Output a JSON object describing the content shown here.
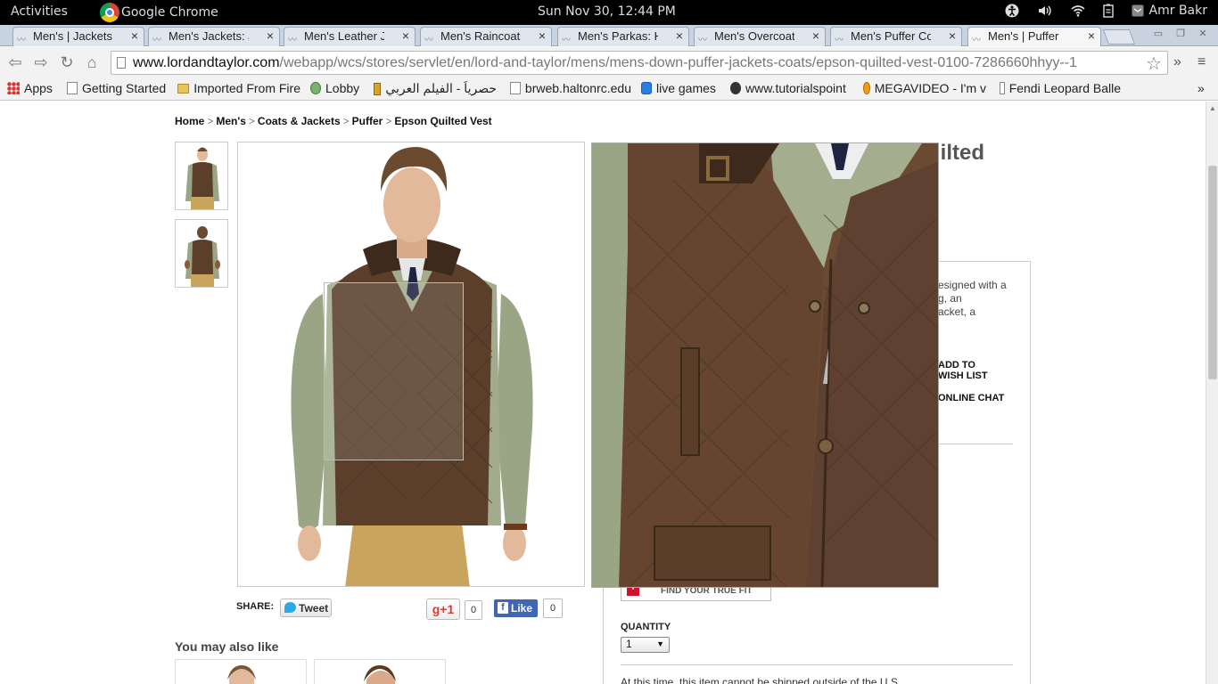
{
  "system": {
    "activities": "Activities",
    "app_name": "Google Chrome",
    "clock": "Sun Nov 30, 12:44 PM",
    "user": "Amr Bakr"
  },
  "tabs": [
    {
      "title": "Men's | Jackets",
      "active": false
    },
    {
      "title": "Men's Jackets: J",
      "active": false
    },
    {
      "title": "Men's Leather Ja",
      "active": false
    },
    {
      "title": "Men's Raincoats",
      "active": false
    },
    {
      "title": "Men's Parkas: H",
      "active": false
    },
    {
      "title": "Men's Overcoat",
      "active": false
    },
    {
      "title": "Men's Puffer Co",
      "active": false
    },
    {
      "title": "Men's | Puffer",
      "active": true
    }
  ],
  "omnibox": {
    "domain": "www.lordandtaylor.com",
    "path": "/webapp/wcs/stores/servlet/en/lord-and-taylor/mens/mens-down-puffer-jackets-coats/epson-quilted-vest-0100-7286660hhyy--1"
  },
  "bookmarks": [
    {
      "label": "Apps",
      "icon": "apps-icon"
    },
    {
      "label": "Getting Started",
      "icon": "page-icon"
    },
    {
      "label": "Imported From Fire",
      "icon": "folder-icon"
    },
    {
      "label": "Lobby",
      "icon": "lobby-icon"
    },
    {
      "label": "حصرياً - الفيلم العربي",
      "icon": "bookmark-icon"
    },
    {
      "label": "brweb.haltonrc.edu",
      "icon": "page-icon"
    },
    {
      "label": "live games",
      "icon": "live-games-icon"
    },
    {
      "label": "www.tutorialspoint",
      "icon": "tutorialspoint-icon"
    },
    {
      "label": "MEGAVIDEO - I'm v",
      "icon": "megavideo-icon"
    },
    {
      "label": "Fendi Leopard Balle",
      "icon": "page-icon"
    }
  ],
  "breadcrumb": [
    {
      "label": "Home"
    },
    {
      "label": "Men's"
    },
    {
      "label": "Coats & Jackets"
    },
    {
      "label": "Puffer"
    },
    {
      "label": "Epson Quilted Vest"
    }
  ],
  "breadcrumb_separator": ">",
  "product": {
    "title_fragment": "uilted",
    "description_lines": [
      "esigned with a",
      "g, an",
      "acket, a"
    ],
    "wish_list": {
      "line1": "ADD TO",
      "line2": "WISH LIST"
    },
    "online_chat": "ONLINE CHAT",
    "true_fit": "FIND YOUR TRUE FIT",
    "quantity_label": "QUANTITY",
    "quantity_value": "1",
    "ship_note": "At this time, this item cannot be shipped outside of the U.S."
  },
  "share": {
    "label": "SHARE:",
    "tweet": "Tweet",
    "gplus": "g+1",
    "gplus_count": "0",
    "like": "Like",
    "like_count": "0"
  },
  "you_may_also_like": "You may also like",
  "colors": {
    "vest_brown": "#5b3f2b",
    "sweater_green": "#9aa585",
    "chino_khaki": "#c9a45c",
    "facebook_blue": "#4267b2",
    "gplus_red": "#d73d32",
    "truefit_red": "#d0112b"
  }
}
